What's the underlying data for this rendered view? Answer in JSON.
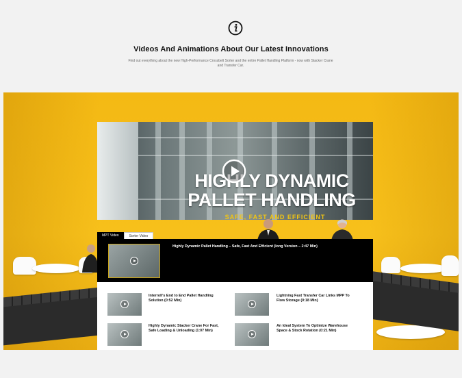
{
  "header": {
    "icon": "info-icon",
    "title": "Videos And Animations About Our Latest Innovations",
    "subtitle": "Find out everything about the new High-Performance Crossbelt Sorter and the entire Pallet Handling Platform - now with Stacker Crane and Transfer Car."
  },
  "hero": {
    "line1": "HIGHLY DYNAMIC",
    "line2": "PALLET HANDLING",
    "tagline": "SAFE, FAST AND EFFICIENT",
    "play_icon": "play-icon"
  },
  "tabs": [
    {
      "label": "MPT Video",
      "active": true
    },
    {
      "label": "Sorter Video",
      "active": false
    }
  ],
  "player": {
    "current_title": "Highly Dynamic Pallet Handling – Safe, Fast And Efficient (long Version – 2:47 Min)"
  },
  "playlist": [
    {
      "title": "Interroll's End to End Pallet Handling Solution (0:52 Min)"
    },
    {
      "title": "Lightning Fast Transfer Car Links MPP To Flow Storage (0:18 Min)"
    },
    {
      "title": "Highly Dynamic Stacker Crane For Fast, Safe Loading & Unloading (1:07 Min)"
    },
    {
      "title": "An Ideal System To Optimize Warehouse Space & Stock Rotation (0:21 Min)"
    }
  ],
  "colors": {
    "stage_yellow": "#f4b914",
    "accent_gold": "#c9a41a",
    "player_bg": "#000000"
  }
}
